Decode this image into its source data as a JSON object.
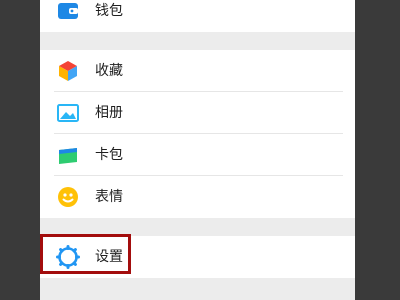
{
  "menu": {
    "wallet": {
      "label": "钱包",
      "icon": "wallet-icon"
    },
    "favorites": {
      "label": "收藏",
      "icon": "favorites-cube-icon"
    },
    "album": {
      "label": "相册",
      "icon": "photo-album-icon"
    },
    "card_pack": {
      "label": "卡包",
      "icon": "card-pack-icon"
    },
    "stickers": {
      "label": "表情",
      "icon": "smiley-face-icon"
    },
    "settings": {
      "label": "设置",
      "icon": "gear-icon"
    }
  },
  "colors": {
    "background_dark": "#424242",
    "panel_gray": "#ececec",
    "row_white": "#ffffff",
    "highlight_border": "#a30d0d",
    "wallet_blue": "#1e88e5",
    "settings_blue": "#2196f3",
    "album_blue": "#29b6f6",
    "card_green": "#2ecc71",
    "smiley_yellow": "#ffc107"
  }
}
